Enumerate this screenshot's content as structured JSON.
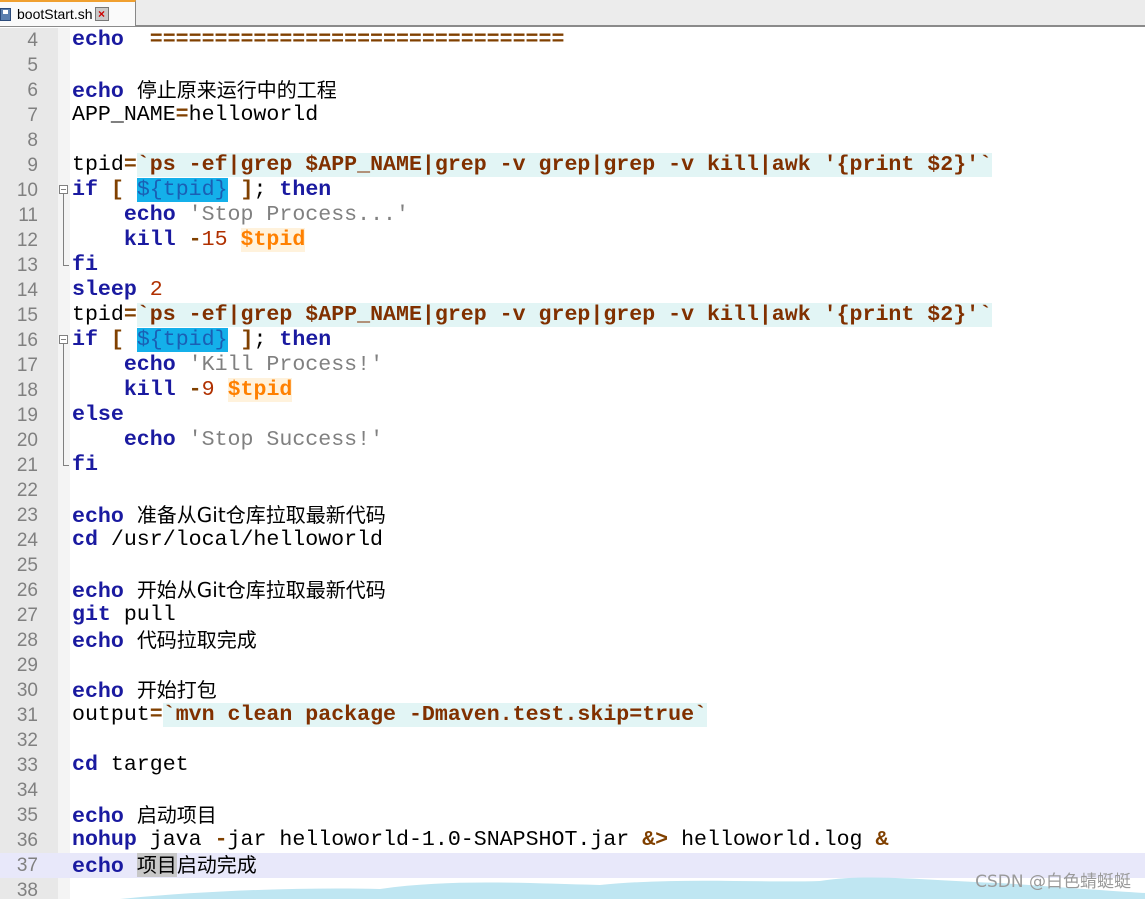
{
  "tab": {
    "title": "bootStart.sh",
    "icon": "save-icon",
    "close_icon": "close-icon"
  },
  "colors": {
    "keyword": "#1a1aa0",
    "operator": "#804000",
    "string": "#808080",
    "variable": "#ff8000",
    "backtick_bg": "#e2f5f5",
    "selection": "#14b0ea",
    "current_line": "#e8e8fa"
  },
  "current_line": 37,
  "lines": [
    {
      "n": "4",
      "segs": [
        [
          "kw",
          "echo"
        ],
        [
          "",
          "  "
        ],
        [
          "op",
          "================================"
        ]
      ]
    },
    {
      "n": "5",
      "segs": []
    },
    {
      "n": "6",
      "segs": [
        [
          "kw",
          "echo"
        ],
        [
          "",
          " "
        ],
        [
          "cjk",
          "停止原来运行中的工程"
        ]
      ]
    },
    {
      "n": "7",
      "segs": [
        [
          "",
          "APP_NAME"
        ],
        [
          "op",
          "="
        ],
        [
          "",
          "helloworld"
        ]
      ]
    },
    {
      "n": "8",
      "segs": []
    },
    {
      "n": "9",
      "segs": [
        [
          "",
          "tpid"
        ],
        [
          "op",
          "="
        ],
        [
          "bt",
          "`ps -ef|grep $APP_NAME|grep -v grep|grep -v kill|awk '{print $2}'`"
        ]
      ]
    },
    {
      "n": "10",
      "fold": "start",
      "segs": [
        [
          "kw",
          "if"
        ],
        [
          "",
          " "
        ],
        [
          "op",
          "["
        ],
        [
          "",
          " "
        ],
        [
          "sel",
          "${tpid}"
        ],
        [
          "",
          " "
        ],
        [
          "op",
          "]"
        ],
        [
          "",
          ";"
        ],
        [
          "",
          " "
        ],
        [
          "kw",
          "then"
        ]
      ]
    },
    {
      "n": "11",
      "fold": "mid",
      "segs": [
        [
          "",
          "    "
        ],
        [
          "kw",
          "echo"
        ],
        [
          "",
          " "
        ],
        [
          "str",
          "'Stop Process...'"
        ]
      ]
    },
    {
      "n": "12",
      "fold": "mid",
      "segs": [
        [
          "",
          "    "
        ],
        [
          "kw",
          "kill"
        ],
        [
          "",
          " "
        ],
        [
          "op",
          "-"
        ],
        [
          "num",
          "15"
        ],
        [
          "",
          " "
        ],
        [
          "var",
          "$tpid"
        ]
      ]
    },
    {
      "n": "13",
      "fold": "end",
      "segs": [
        [
          "kw",
          "fi"
        ]
      ]
    },
    {
      "n": "14",
      "segs": [
        [
          "kw",
          "sleep"
        ],
        [
          "",
          " "
        ],
        [
          "num",
          "2"
        ]
      ]
    },
    {
      "n": "15",
      "segs": [
        [
          "",
          "tpid"
        ],
        [
          "op",
          "="
        ],
        [
          "bt",
          "`ps -ef|grep $APP_NAME|grep -v grep|grep -v kill|awk '{print $2}'`"
        ]
      ]
    },
    {
      "n": "16",
      "fold": "start",
      "segs": [
        [
          "kw",
          "if"
        ],
        [
          "",
          " "
        ],
        [
          "op",
          "["
        ],
        [
          "",
          " "
        ],
        [
          "sel",
          "${tpid}"
        ],
        [
          "",
          " "
        ],
        [
          "op",
          "]"
        ],
        [
          "",
          ";"
        ],
        [
          "",
          " "
        ],
        [
          "kw",
          "then"
        ]
      ]
    },
    {
      "n": "17",
      "fold": "mid",
      "segs": [
        [
          "",
          "    "
        ],
        [
          "kw",
          "echo"
        ],
        [
          "",
          " "
        ],
        [
          "str",
          "'Kill Process!'"
        ]
      ]
    },
    {
      "n": "18",
      "fold": "mid",
      "segs": [
        [
          "",
          "    "
        ],
        [
          "kw",
          "kill"
        ],
        [
          "",
          " "
        ],
        [
          "op",
          "-"
        ],
        [
          "num",
          "9"
        ],
        [
          "",
          " "
        ],
        [
          "var",
          "$tpid"
        ]
      ]
    },
    {
      "n": "19",
      "fold": "mid",
      "segs": [
        [
          "kw",
          "else"
        ]
      ]
    },
    {
      "n": "20",
      "fold": "mid",
      "segs": [
        [
          "",
          "    "
        ],
        [
          "kw",
          "echo"
        ],
        [
          "",
          " "
        ],
        [
          "str",
          "'Stop Success!'"
        ]
      ]
    },
    {
      "n": "21",
      "fold": "end",
      "segs": [
        [
          "kw",
          "fi"
        ]
      ]
    },
    {
      "n": "22",
      "segs": []
    },
    {
      "n": "23",
      "segs": [
        [
          "kw",
          "echo"
        ],
        [
          "",
          " "
        ],
        [
          "cjk",
          "准备从Git仓库拉取最新代码"
        ]
      ]
    },
    {
      "n": "24",
      "segs": [
        [
          "kw",
          "cd"
        ],
        [
          "",
          " /usr/local/helloworld"
        ]
      ]
    },
    {
      "n": "25",
      "segs": []
    },
    {
      "n": "26",
      "segs": [
        [
          "kw",
          "echo"
        ],
        [
          "",
          " "
        ],
        [
          "cjk",
          "开始从Git仓库拉取最新代码"
        ]
      ]
    },
    {
      "n": "27",
      "segs": [
        [
          "kw",
          "git"
        ],
        [
          "",
          " pull"
        ]
      ]
    },
    {
      "n": "28",
      "segs": [
        [
          "kw",
          "echo"
        ],
        [
          "",
          " "
        ],
        [
          "cjk",
          "代码拉取完成"
        ]
      ]
    },
    {
      "n": "29",
      "segs": []
    },
    {
      "n": "30",
      "segs": [
        [
          "kw",
          "echo"
        ],
        [
          "",
          " "
        ],
        [
          "cjk",
          "开始打包"
        ]
      ]
    },
    {
      "n": "31",
      "segs": [
        [
          "",
          "output"
        ],
        [
          "op",
          "="
        ],
        [
          "bt",
          "`mvn clean package -Dmaven.test.skip=true`"
        ]
      ]
    },
    {
      "n": "32",
      "segs": []
    },
    {
      "n": "33",
      "segs": [
        [
          "kw",
          "cd"
        ],
        [
          "",
          " target"
        ]
      ]
    },
    {
      "n": "34",
      "segs": []
    },
    {
      "n": "35",
      "segs": [
        [
          "kw",
          "echo"
        ],
        [
          "",
          " "
        ],
        [
          "cjk",
          "启动项目"
        ]
      ]
    },
    {
      "n": "36",
      "segs": [
        [
          "kw",
          "nohup"
        ],
        [
          "",
          " java "
        ],
        [
          "op",
          "-"
        ],
        [
          "",
          "jar helloworld-1.0-SNAPSHOT.jar "
        ],
        [
          "op",
          "&>"
        ],
        [
          "",
          " helloworld.log "
        ],
        [
          "op",
          "&"
        ]
      ]
    },
    {
      "n": "37",
      "segs": [
        [
          "kw",
          "echo"
        ],
        [
          "",
          " "
        ],
        [
          "cjk hl",
          "项目"
        ],
        [
          "cjk",
          "启动完成"
        ]
      ]
    },
    {
      "n": "38",
      "segs": []
    }
  ],
  "watermark": "CSDN @白色蜻蜓蜓"
}
